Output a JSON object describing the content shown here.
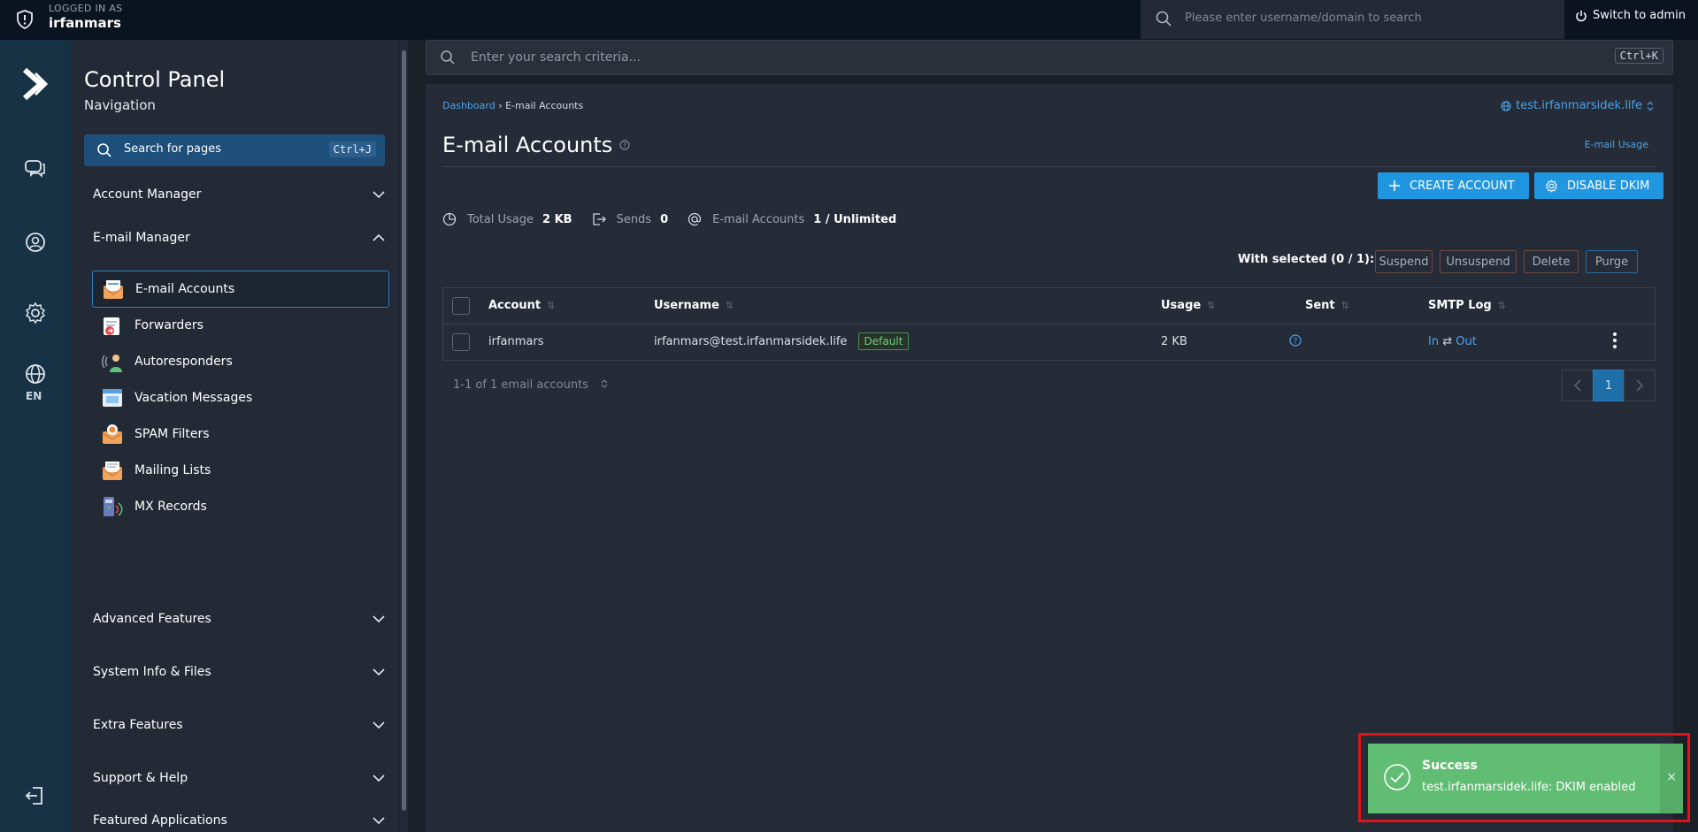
{
  "topbar": {
    "logged_in_caption": "LOGGED IN AS",
    "username": "irfanmars",
    "search_placeholder": "Please enter username/domain to search",
    "switch_label": "Switch to admin"
  },
  "rail": {
    "language": "EN",
    "icons": [
      "messages-icon",
      "user-icon",
      "gear-icon",
      "globe-icon",
      "logout-icon"
    ]
  },
  "sidebar": {
    "title": "Control Panel",
    "subtitle": "Navigation",
    "search_label": "Search for pages",
    "search_shortcut": "Ctrl+J",
    "groups": [
      {
        "label": "Account Manager",
        "expanded": false
      },
      {
        "label": "E-mail Manager",
        "expanded": true
      },
      {
        "label": "Advanced Features",
        "expanded": false
      },
      {
        "label": "System Info & Files",
        "expanded": false
      },
      {
        "label": "Extra Features",
        "expanded": false
      },
      {
        "label": "Support & Help",
        "expanded": false
      },
      {
        "label": "Featured Applications",
        "expanded": false
      }
    ],
    "email_items": [
      {
        "label": "E-mail Accounts",
        "active": true
      },
      {
        "label": "Forwarders"
      },
      {
        "label": "Autoresponders"
      },
      {
        "label": "Vacation Messages"
      },
      {
        "label": "SPAM Filters"
      },
      {
        "label": "Mailing Lists"
      },
      {
        "label": "MX Records"
      }
    ]
  },
  "main": {
    "search_placeholder": "Enter your search criteria...",
    "search_shortcut": "Ctrl+K",
    "breadcrumb": {
      "root": "Dashboard",
      "separator": "›",
      "current": "E-mail Accounts"
    },
    "domain": "test.irfanmarsidek.life",
    "title": "E-mail Accounts",
    "usage_link": "E-mail Usage",
    "buttons": {
      "create": "CREATE ACCOUNT",
      "dkim": "DISABLE DKIM"
    },
    "stats": {
      "total_usage_label": "Total Usage",
      "total_usage_value": "2 KB",
      "sends_label": "Sends",
      "sends_value": "0",
      "accounts_label": "E-mail Accounts",
      "accounts_value": "1 / Unlimited"
    },
    "with_selected": "With selected (0 / 1):",
    "actions": [
      "Suspend",
      "Unsuspend",
      "Delete",
      "Purge"
    ],
    "table": {
      "columns": [
        "Account",
        "Username",
        "Usage",
        "Sent",
        "SMTP Log"
      ],
      "rows": [
        {
          "account": "irfanmars",
          "username": "irfanmars@test.irfanmarsidek.life",
          "badge": "Default",
          "usage": "2 KB",
          "sent": "?",
          "smtp_in": "In",
          "smtp_sep": "⇄",
          "smtp_out": "Out"
        }
      ]
    },
    "footer_count": "1-1 of 1 email accounts",
    "pager": {
      "current": "1"
    }
  },
  "toast": {
    "title": "Success",
    "message": "test.irfanmarsidek.life: DKIM enabled",
    "close": "×"
  },
  "colors": {
    "accent": "#2196e0",
    "link": "#4aa3ea",
    "success": "#62bd74",
    "highlight": "#e0121a"
  }
}
